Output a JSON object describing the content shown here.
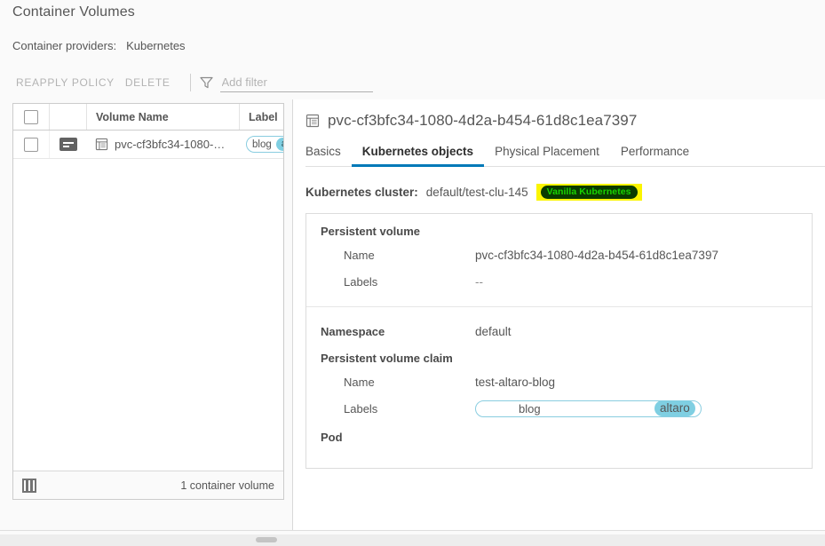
{
  "page": {
    "title": "Container Volumes",
    "providers_label": "Container providers:",
    "providers_value": "Kubernetes"
  },
  "actionbar": {
    "reapply_policy": "REAPPLY POLICY",
    "delete": "DELETE",
    "filter_icon": "funnel-icon",
    "filter_placeholder": "Add filter",
    "filter_value": ""
  },
  "grid": {
    "columns": [
      "",
      "",
      "Volume Name",
      "Label"
    ],
    "rows": [
      {
        "checked": false,
        "detail_icon": "detail-view-icon",
        "volume_icon": "container-volume-icon",
        "name": "pvc-cf3bfc34-1080-…",
        "label_key": "blog",
        "label_value": "altaro"
      }
    ],
    "footer": {
      "split_icon": "split-pane-icon",
      "count": "1 container volume"
    }
  },
  "detail": {
    "icon": "container-volume-icon",
    "title": "pvc-cf3bfc34-1080-4d2a-b454-61d8c1ea7397",
    "tabs": [
      {
        "label": "Basics",
        "active": false
      },
      {
        "label": "Kubernetes objects",
        "active": true
      },
      {
        "label": "Physical Placement",
        "active": false
      },
      {
        "label": "Performance",
        "active": false
      }
    ],
    "cluster": {
      "label": "Kubernetes cluster:",
      "value": "default/test-clu-145",
      "badge": "Vanilla Kubernetes",
      "badge_text_color": "#19d400",
      "badge_bg_color": "#093b00",
      "highlight_color": "#fbf500"
    },
    "sections": [
      {
        "heading": "Persistent volume",
        "rows": [
          {
            "key": "Name",
            "value": "pvc-cf3bfc34-1080-4d2a-b454-61d8c1ea7397",
            "type": "text"
          },
          {
            "key": "Labels",
            "value": "--",
            "type": "empty"
          }
        ]
      },
      {
        "heading": "",
        "rows": [
          {
            "key": "Namespace",
            "value": "default",
            "type": "text",
            "top": true
          }
        ]
      },
      {
        "heading": "Persistent volume claim",
        "rows": [
          {
            "key": "Name",
            "value": "test-altaro-blog",
            "type": "text"
          },
          {
            "key": "Labels",
            "value": "",
            "type": "chip",
            "chip_key": "blog",
            "chip_value": "altaro"
          }
        ]
      },
      {
        "heading": "Pod",
        "rows": []
      }
    ]
  },
  "scrollbar": {
    "orientation": "horizontal",
    "thumb": "horizontal-scrollbar-thumb"
  },
  "colors": {
    "accent": "#0079b8",
    "chip_border": "#89cde0",
    "chip_value_bg": "#7fcfe2",
    "text": "#565656",
    "page_bg": "#fafafa"
  }
}
